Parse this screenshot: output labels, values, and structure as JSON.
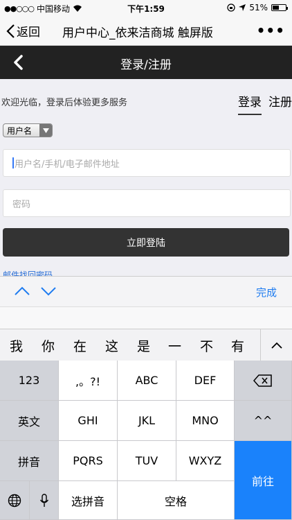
{
  "status_bar": {
    "carrier": "中国移动",
    "time": "下午1:59",
    "battery": "51%",
    "battery_level": 0.51
  },
  "nav": {
    "back_label": "返回",
    "title": "用户中心_依来洁商城 触屏版",
    "more": "•••"
  },
  "page": {
    "title": "登录/注册"
  },
  "login": {
    "welcome": "欢迎光临，登录后体验更多服务",
    "tab_login": "登录",
    "tab_register": "注册",
    "account_type": "用户名",
    "username_placeholder": "用户名/手机/电子邮件地址",
    "password_placeholder": "密码",
    "submit": "立即登陆",
    "forgot": "邮件找回密码"
  },
  "accessory": {
    "done": "完成"
  },
  "candidates": [
    "我",
    "你",
    "在",
    "这",
    "是",
    "一",
    "不",
    "有"
  ],
  "keyboard": {
    "row1": [
      "123",
      ",。?!",
      "ABC",
      "DEF"
    ],
    "row2": [
      "英文",
      "GHI",
      "JKL",
      "MNO",
      "^^"
    ],
    "row3": [
      "拼音",
      "PQRS",
      "TUV",
      "WXYZ"
    ],
    "go": "前往",
    "row4": {
      "select_pinyin": "选拼音",
      "space": "空格"
    }
  }
}
